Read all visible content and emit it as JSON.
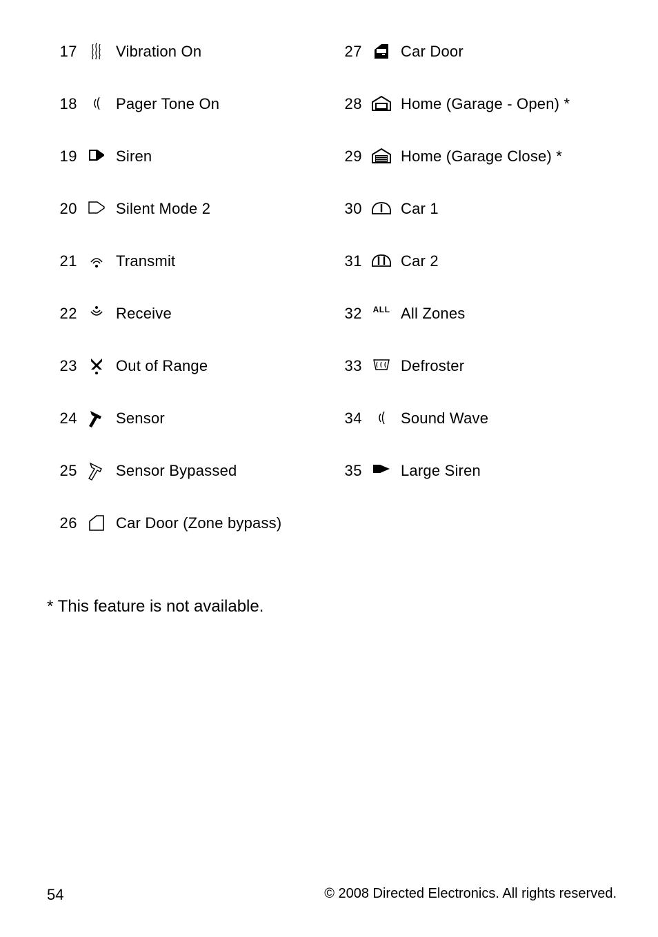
{
  "left": [
    {
      "n": "17",
      "label": "Vibration On",
      "icon": "vibration"
    },
    {
      "n": "18",
      "label": "Pager Tone On",
      "icon": "sound-wave"
    },
    {
      "n": "19",
      "label": "Siren",
      "icon": "siren"
    },
    {
      "n": "20",
      "label": "Silent Mode 2",
      "icon": "silent"
    },
    {
      "n": "21",
      "label": "Transmit",
      "icon": "transmit"
    },
    {
      "n": "22",
      "label": "Receive",
      "icon": "receive"
    },
    {
      "n": "23",
      "label": "Out of Range",
      "icon": "out-of-range"
    },
    {
      "n": "24",
      "label": "Sensor",
      "icon": "sensor"
    },
    {
      "n": "25",
      "label": "Sensor Bypassed",
      "icon": "sensor-bypass"
    },
    {
      "n": "26",
      "label": "Car Door (Zone bypass)",
      "icon": "car-door-bypass"
    }
  ],
  "right": [
    {
      "n": "27",
      "label": "Car Door",
      "icon": "car-door"
    },
    {
      "n": "28",
      "label": "Home (Garage - Open) *",
      "icon": "garage-open"
    },
    {
      "n": "29",
      "label": "Home (Garage Close) *",
      "icon": "garage-close"
    },
    {
      "n": "30",
      "label": "Car 1",
      "icon": "car1"
    },
    {
      "n": "31",
      "label": "Car 2",
      "icon": "car2"
    },
    {
      "n": "32",
      "label": "All Zones",
      "icon": "all"
    },
    {
      "n": "33",
      "label": "Defroster",
      "icon": "defroster"
    },
    {
      "n": "34",
      "label": "Sound Wave",
      "icon": "sound-wave"
    },
    {
      "n": "35",
      "label": "Large Siren",
      "icon": "large-siren"
    }
  ],
  "footnote": "* This feature is not available.",
  "page_number": "54",
  "copyright": "© 2008 Directed Electronics. All rights reserved."
}
